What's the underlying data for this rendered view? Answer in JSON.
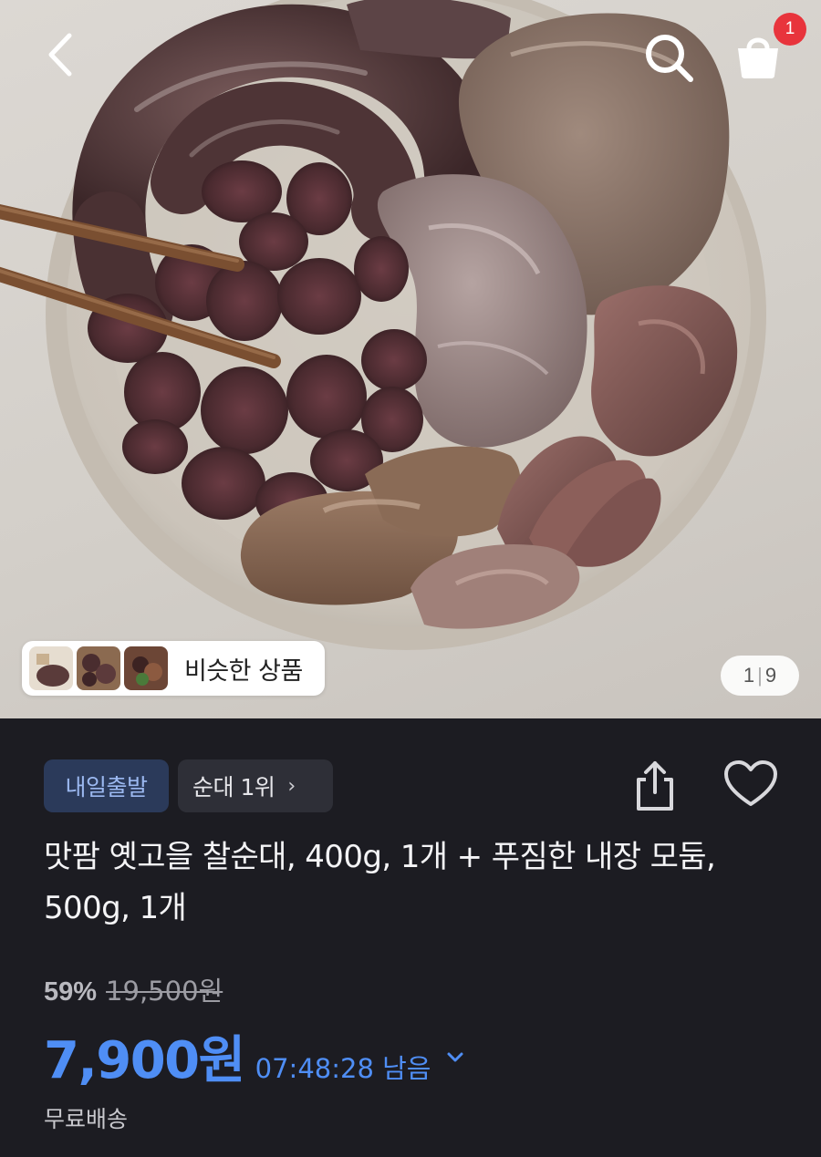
{
  "header": {
    "back_icon": "chevron-left-icon",
    "search_icon": "search-icon",
    "cart_icon": "shopping-bag-icon",
    "cart_badge": "1"
  },
  "gallery": {
    "similar_label": "비슷한 상품",
    "page_current": "1",
    "page_total": "9"
  },
  "product": {
    "badge_label": "내일출발",
    "rank_label": "순대 1위",
    "rank_chevron": "›",
    "title": "맛팜 옛고을 찰순대, 400g, 1개 + 푸짐한 내장 모둠, 500g, 1개",
    "discount": "59%",
    "original_price": "19,500원",
    "price": "7,900원",
    "timer": "07:48:28 남음",
    "shipping": "무료배송",
    "share_icon": "share-icon",
    "heart_icon": "heart-icon"
  },
  "colors": {
    "accent": "#4f8ef5",
    "badge_bg": "#2b3a5a",
    "badge_text": "#9bb8f0",
    "cart_badge": "#e8343c",
    "background": "#1c1c22"
  }
}
